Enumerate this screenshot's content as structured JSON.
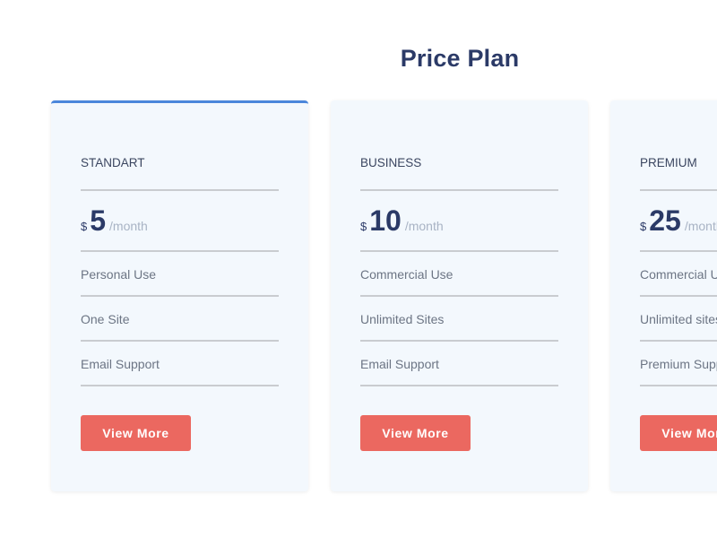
{
  "header": {
    "title": "Price Plan"
  },
  "colors": {
    "accent": "#4a86db",
    "button": "#eb6860",
    "heading": "#2b3a67",
    "card_bg": "#f3f8fd"
  },
  "plans": [
    {
      "name": "Standart",
      "currency": "$",
      "amount": "5",
      "period": "/month",
      "features": [
        "Personal Use",
        "One Site",
        "Email Support"
      ],
      "button_label": "View More",
      "active": true
    },
    {
      "name": "Business",
      "currency": "$",
      "amount": "10",
      "period": "/month",
      "features": [
        "Commercial Use",
        "Unlimited Sites",
        "Email Support"
      ],
      "button_label": "View More",
      "active": false
    },
    {
      "name": "Premium",
      "currency": "$",
      "amount": "25",
      "period": "/month",
      "features": [
        "Commercial Use",
        "Unlimited sites",
        "Premium Support"
      ],
      "button_label": "View More",
      "active": false
    }
  ]
}
